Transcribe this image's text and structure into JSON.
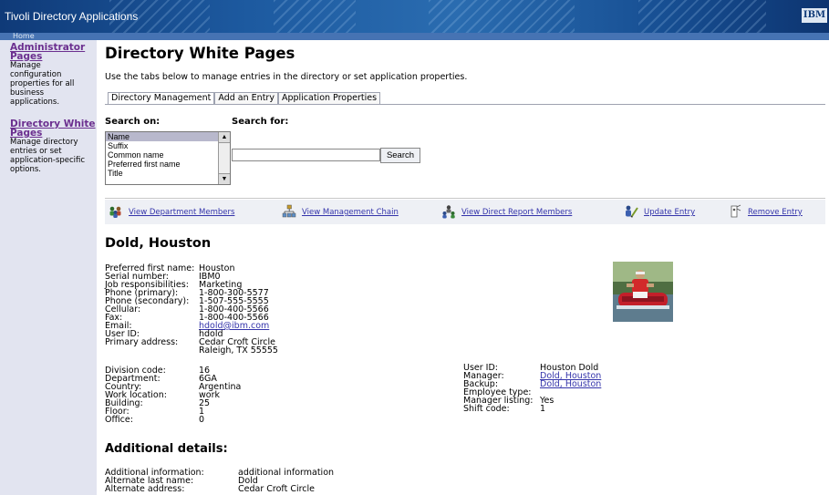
{
  "app": {
    "title": "Tivoli Directory Applications",
    "logo": "IBM",
    "home_label": "Home"
  },
  "sidebar": {
    "items": [
      {
        "label": "Administrator Pages",
        "description": "Manage configuration properties for all business applications."
      },
      {
        "label": "Directory White Pages",
        "description": "Manage directory entries or set application-specific options."
      }
    ]
  },
  "page": {
    "title": "Directory White Pages",
    "intro": "Use the tabs below to manage entries in the directory or set application properties."
  },
  "tabs": [
    {
      "label": "Directory Management",
      "active": true
    },
    {
      "label": "Add an Entry",
      "active": false
    },
    {
      "label": "Application Properties",
      "active": false
    }
  ],
  "search": {
    "on_label": "Search on:",
    "for_label": "Search for:",
    "options": [
      "Name",
      "Suffix",
      "Common name",
      "Preferred first name",
      "Title"
    ],
    "selected": "Name",
    "value": "",
    "button_label": "Search"
  },
  "actions": [
    {
      "label": "View Department Members",
      "icon": "department-members-icon"
    },
    {
      "label": "View Management Chain",
      "icon": "management-chain-icon"
    },
    {
      "label": "View Direct Report Members",
      "icon": "direct-reports-icon"
    },
    {
      "label": "Update Entry",
      "icon": "update-entry-icon"
    },
    {
      "label": "Remove Entry",
      "icon": "remove-entry-icon"
    }
  ],
  "person": {
    "name": "Dold, Houston"
  },
  "details_left": [
    {
      "key": "Preferred first name:",
      "value": "Houston"
    },
    {
      "key": "Serial number:",
      "value": "IBM0"
    },
    {
      "key": "Job responsibilities:",
      "value": "Marketing"
    },
    {
      "key": "Phone (primary):",
      "value": "1-800-300-5577"
    },
    {
      "key": "Phone (secondary):",
      "value": "1-507-555-5555"
    },
    {
      "key": "Cellular:",
      "value": "1-800-400-5566"
    },
    {
      "key": "Fax:",
      "value": "1-800-400-5566"
    },
    {
      "key": "Email:",
      "value": "hdold@ibm.com",
      "link": true
    },
    {
      "key": "User ID:",
      "value": "hdold"
    },
    {
      "key": "Primary address:",
      "value": "Cedar Croft Circle"
    },
    {
      "key": "",
      "value": "Raleigh, TX 55555"
    }
  ],
  "details_left2": [
    {
      "key": "Division code:",
      "value": "16"
    },
    {
      "key": "Department:",
      "value": "6GA"
    },
    {
      "key": "Country:",
      "value": "Argentina"
    },
    {
      "key": "Work location:",
      "value": "work"
    },
    {
      "key": "Building:",
      "value": "25"
    },
    {
      "key": "Floor:",
      "value": "1"
    },
    {
      "key": "Office:",
      "value": "0"
    }
  ],
  "details_right": [
    {
      "key": "User ID:",
      "value": "Houston Dold"
    },
    {
      "key": "Manager:",
      "value": "Dold, Houston",
      "link": true
    },
    {
      "key": "Backup:",
      "value": "Dold, Houston",
      "link": true
    },
    {
      "key": "Employee type:",
      "value": ""
    },
    {
      "key": "Manager listing:",
      "value": "Yes"
    },
    {
      "key": "Shift code:",
      "value": "1"
    }
  ],
  "additional": {
    "title": "Additional details:",
    "rows": [
      {
        "key": "Additional information:",
        "value": "additional information"
      },
      {
        "key": "Alternate last name:",
        "value": "Dold"
      },
      {
        "key": "Alternate address:",
        "value": "Cedar Croft Circle"
      }
    ]
  },
  "colors": {
    "banner": "#1d5aa0",
    "home_bar": "#4673b3",
    "sidebar_bg": "#e2e4f0",
    "sidebar_link": "#6b2f8f",
    "link": "#3333aa",
    "action_bar_bg": "#eef0f5"
  }
}
